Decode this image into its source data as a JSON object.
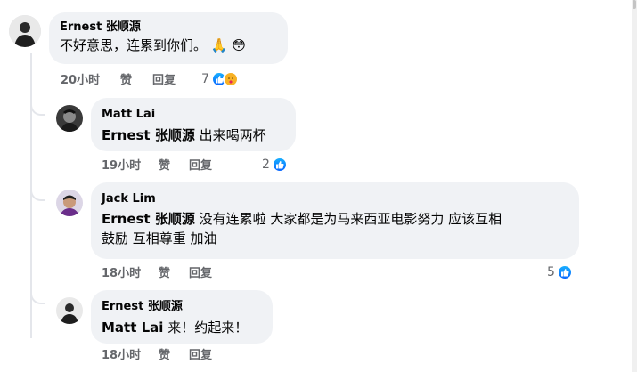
{
  "comments": [
    {
      "author": "Ernest 张顺源",
      "text": "不好意思，连累到你们。",
      "emojis": [
        "🙏",
        "😳"
      ],
      "time": "20小时",
      "like": "赞",
      "reply": "回复",
      "reaction_count": "7",
      "reactions": [
        "like-icon",
        "care-icon"
      ]
    },
    {
      "author": "Matt Lai",
      "tag": "Ernest 张顺源",
      "text": "出来喝两杯",
      "time": "19小时",
      "like": "赞",
      "reply": "回复",
      "reaction_count": "2",
      "reactions": [
        "like-icon"
      ]
    },
    {
      "author": "Jack Lim",
      "tag": "Ernest 张顺源",
      "text": "没有连累啦 大家都是为马来西亚电影努力 应该互相",
      "text2": "鼓励 互相尊重 加油",
      "time": "18小时",
      "like": "赞",
      "reply": "回复",
      "reaction_count": "5",
      "reactions": [
        "like-icon"
      ]
    },
    {
      "author": "Ernest 张顺源",
      "tag": "Matt Lai",
      "text": "来！约起来！",
      "time": "18小时",
      "like": "赞",
      "reply": "回复"
    }
  ],
  "colors": {
    "bubble": "#f0f2f5",
    "meta": "#65676b",
    "like_blue": "#0866ff"
  }
}
